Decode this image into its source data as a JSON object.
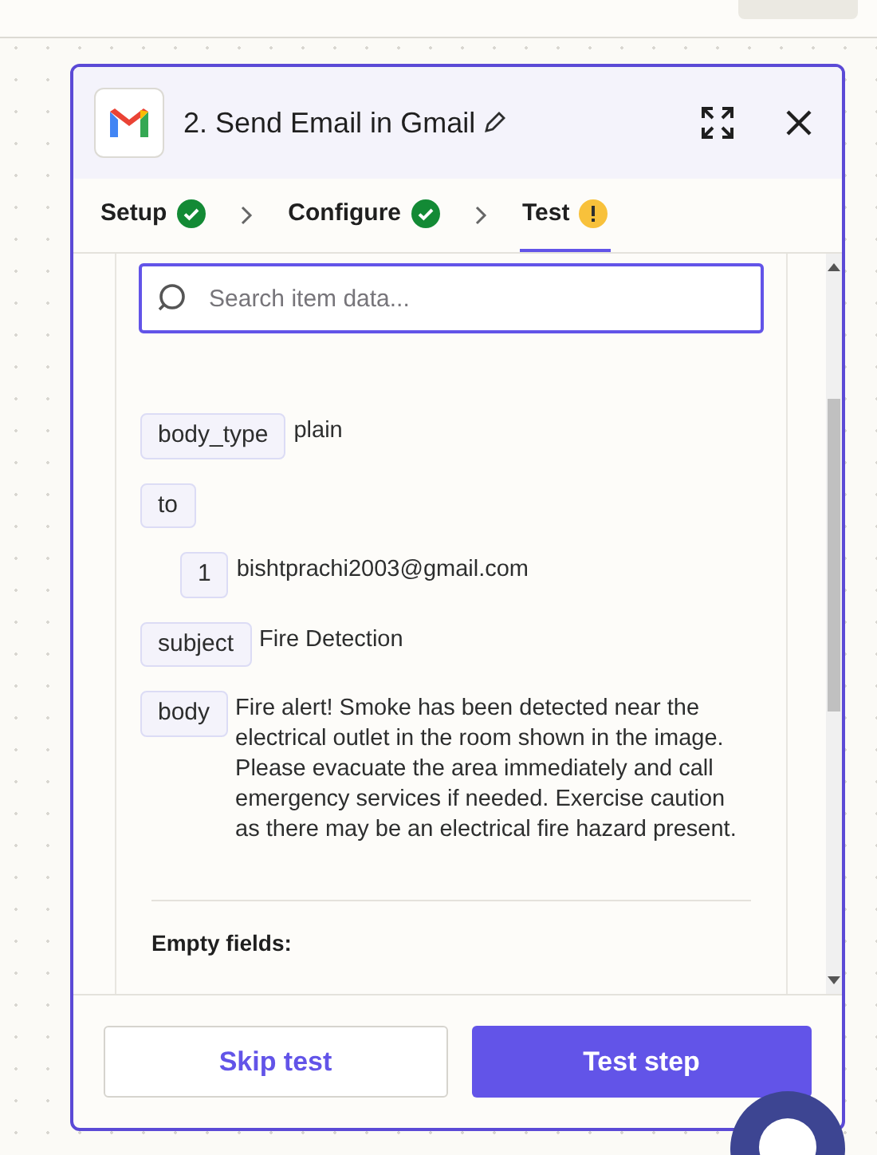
{
  "panel": {
    "step_title": "2. Send Email in Gmail",
    "tabs": [
      {
        "label": "Setup",
        "complete": true,
        "selected": false
      },
      {
        "label": "Configure",
        "complete": true,
        "selected": false
      },
      {
        "label": "Test",
        "complete": false,
        "selected": true
      }
    ],
    "search": {
      "placeholder": "Search item data..."
    },
    "fields": [
      {
        "key": "body_type",
        "value": "plain"
      },
      {
        "key": "to",
        "children": [
          {
            "key": "1",
            "value": "bishtprachi2003@gmail.com"
          }
        ]
      },
      {
        "key": "subject",
        "value": "Fire Detection"
      },
      {
        "key": "body",
        "value": "Fire alert! Smoke has been detected near the electrical outlet in the room shown in the image. Please evacuate the area immediately and call emergency services if needed. Exercise caution as there may be an electrical fire hazard present."
      }
    ],
    "empty_fields_heading": "Empty fields:",
    "buttons": [
      {
        "label": "Skip test",
        "kind": "secondary"
      },
      {
        "label": "Test step",
        "kind": "primary"
      }
    ]
  }
}
